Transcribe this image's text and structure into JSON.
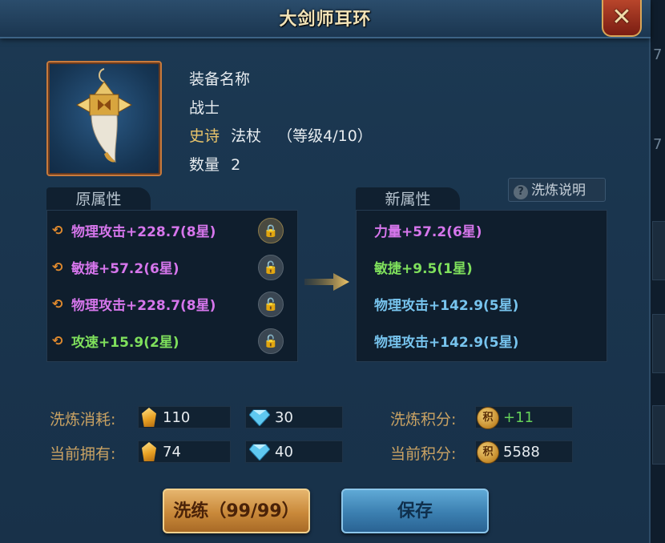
{
  "title": "大剑师耳环",
  "item": {
    "name": "装备名称",
    "class": "战士",
    "quality": "史诗",
    "type": "法杖",
    "level_text": "（等级4/10）",
    "quantity_label": "数量",
    "quantity": "2"
  },
  "help_label": "洗炼说明",
  "original": {
    "tab": "原属性",
    "rows": [
      {
        "text": "物理攻击+228.7(8星)",
        "color": "#d676ec",
        "locked": true
      },
      {
        "text": "敏捷+57.2(6星)",
        "color": "#d676ec",
        "locked": false
      },
      {
        "text": "物理攻击+228.7(8星)",
        "color": "#d676ec",
        "locked": false
      },
      {
        "text": "攻速+15.9(2星)",
        "color": "#7fe05c",
        "locked": false
      }
    ]
  },
  "new": {
    "tab": "新属性",
    "rows": [
      {
        "text": "力量+57.2(6星)",
        "color": "#d676ec"
      },
      {
        "text": "敏捷+9.5(1星)",
        "color": "#7fe05c"
      },
      {
        "text": "物理攻击+142.9(5星)",
        "color": "#77c4ee"
      },
      {
        "text": "物理攻击+142.9(5星)",
        "color": "#77c4ee"
      }
    ]
  },
  "costs": {
    "cost_label": "洗炼消耗:",
    "cost_gold": "110",
    "cost_gem": "30",
    "own_label": "当前拥有:",
    "own_gold": "74",
    "own_gem": "40",
    "score_gain_label": "洗炼积分:",
    "score_gain": "+11",
    "score_label": "当前积分:",
    "score": "5588",
    "score_icon_text": "积"
  },
  "buttons": {
    "refine": "洗练（99/99）",
    "save": "保存"
  },
  "side": {
    "digit": "7"
  }
}
